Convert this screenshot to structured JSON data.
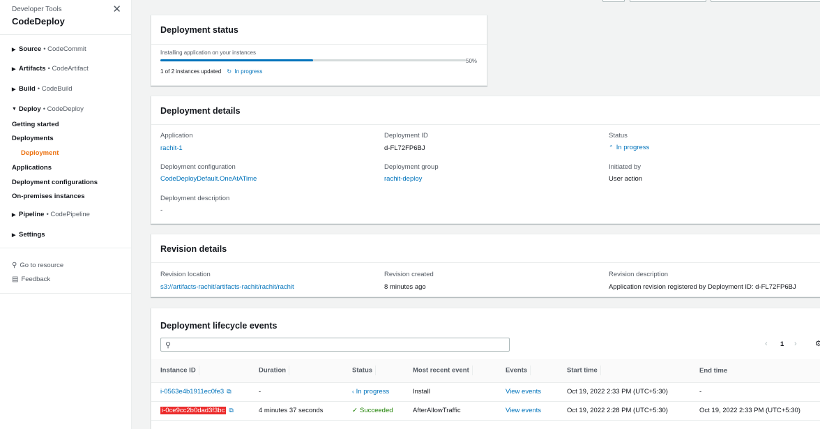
{
  "sidebar": {
    "category": "Developer Tools",
    "title": "CodeDeploy",
    "groups": [
      {
        "label": "Source",
        "sub": "• CodeCommit"
      },
      {
        "label": "Artifacts",
        "sub": "• CodeArtifact"
      },
      {
        "label": "Build",
        "sub": "• CodeBuild"
      },
      {
        "label": "Deploy",
        "sub": "• CodeDeploy"
      },
      {
        "label": "Pipeline",
        "sub": "• CodePipeline"
      },
      {
        "label": "Settings",
        "sub": ""
      }
    ],
    "deploy_items": [
      "Getting started",
      "Deployments",
      "Deployment",
      "Applications",
      "Deployment configurations",
      "On-premises instances"
    ],
    "go_to_resource": "Go to resource",
    "feedback": "Feedback"
  },
  "status_panel": {
    "title": "Deployment status",
    "progress_label": "Installing application on your instances",
    "progress_value": 50,
    "progress_text": "50%",
    "instances_text": "1 of 2 instances updated",
    "status_text": "In progress"
  },
  "details": {
    "title": "Deployment details",
    "application_label": "Application",
    "application_value": "rachit-1",
    "deployment_id_label": "Deployment ID",
    "deployment_id_value": "d-FL72FP6BJ",
    "status_label": "Status",
    "status_value": "In progress",
    "config_label": "Deployment configuration",
    "config_value": "CodeDeployDefault.OneAtATime",
    "group_label": "Deployment group",
    "group_value": "rachit-deploy",
    "initiated_label": "Initiated by",
    "initiated_value": "User action",
    "description_label": "Deployment description",
    "description_value": "-"
  },
  "revision": {
    "title": "Revision details",
    "location_label": "Revision location",
    "location_value": "s3://artifacts-rachit/artifacts-rachit/rachit/rachit",
    "created_label": "Revision created",
    "created_value": "8 minutes ago",
    "description_label": "Revision description",
    "description_value": "Application revision registered by Deployment ID: d-FL72FP6BJ"
  },
  "lifecycle": {
    "title": "Deployment lifecycle events",
    "search_placeholder": "",
    "page": "1",
    "columns": [
      "Instance ID",
      "Duration",
      "Status",
      "Most recent event",
      "Events",
      "Start time",
      "End time"
    ],
    "rows": [
      {
        "instance": "i-0563e4b1911ec0fe3",
        "duration": "-",
        "status": "In progress",
        "event": "Install",
        "events": "View events",
        "start": "Oct 19, 2022 2:33 PM (UTC+5:30)",
        "end": "-"
      },
      {
        "instance": "i-0ce9cc2b0dad3f3bc",
        "duration": "4 minutes 37 seconds",
        "status": "Succeeded",
        "event": "AfterAllowTraffic",
        "events": "View events",
        "start": "Oct 19, 2022 2:28 PM (UTC+5:30)",
        "end": "Oct 19, 2022 2:33 PM (UTC+5:30)"
      }
    ]
  }
}
